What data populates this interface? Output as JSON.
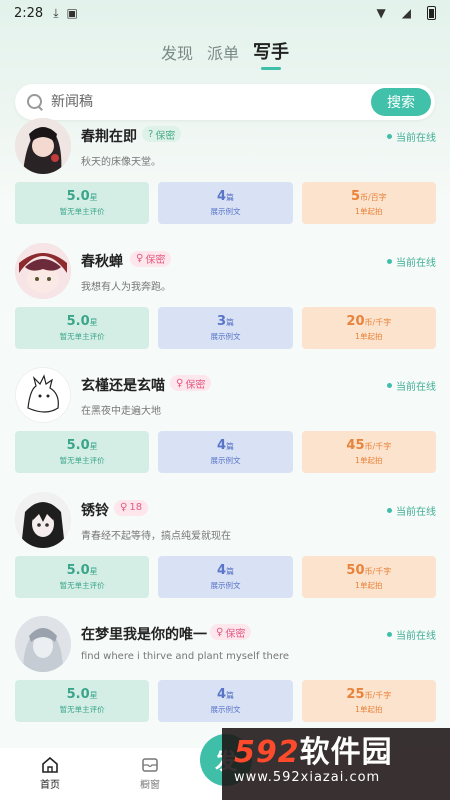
{
  "status": {
    "time": "2:28"
  },
  "tabs": [
    {
      "label": "发现"
    },
    {
      "label": "派单"
    },
    {
      "label": "写手"
    }
  ],
  "search": {
    "placeholder": "新闻稿",
    "button": "搜索"
  },
  "writers": [
    {
      "name": "春荆在即",
      "badge": "保密",
      "badge_icon": "question-icon",
      "badge_color": "green",
      "desc": "秋天的床像天堂。",
      "online": "当前在线",
      "rating": "5.0",
      "rating_unit": "星",
      "rating_label": "暂无单主评价",
      "samples": "4",
      "samples_unit": "篇",
      "samples_label": "展示例文",
      "price": "5",
      "price_unit": "币/百字",
      "price_label": "1单起拍"
    },
    {
      "name": "春秋蝉",
      "badge": "保密",
      "badge_icon": "female-icon",
      "badge_color": "pink",
      "desc": "我想有人为我奔跑。",
      "online": "当前在线",
      "rating": "5.0",
      "rating_unit": "星",
      "rating_label": "暂无单主评价",
      "samples": "3",
      "samples_unit": "篇",
      "samples_label": "展示例文",
      "price": "20",
      "price_unit": "币/千字",
      "price_label": "1单起拍"
    },
    {
      "name": "玄槿还是玄喵",
      "badge": "保密",
      "badge_icon": "female-icon",
      "badge_color": "pink",
      "desc": "在黑夜中走遍大地",
      "online": "当前在线",
      "rating": "5.0",
      "rating_unit": "星",
      "rating_label": "暂无单主评价",
      "samples": "4",
      "samples_unit": "篇",
      "samples_label": "展示例文",
      "price": "45",
      "price_unit": "币/千字",
      "price_label": "1单起拍"
    },
    {
      "name": "锈铃",
      "badge": "18",
      "badge_icon": "female-icon",
      "badge_color": "pink",
      "desc": "青春经不起等待，搞点纯爱就现在",
      "online": "当前在线",
      "rating": "5.0",
      "rating_unit": "星",
      "rating_label": "暂无单主评价",
      "samples": "4",
      "samples_unit": "篇",
      "samples_label": "展示例文",
      "price": "50",
      "price_unit": "币/千字",
      "price_label": "1单起拍"
    },
    {
      "name": "在梦里我是你的唯一",
      "badge": "保密",
      "badge_icon": "female-icon",
      "badge_color": "pink",
      "desc": "find where i thirve and plant myself there",
      "online": "当前在线",
      "rating": "5.0",
      "rating_unit": "星",
      "rating_label": "暂无单主评价",
      "samples": "4",
      "samples_unit": "篇",
      "samples_label": "展示例文",
      "price": "25",
      "price_unit": "币/千字",
      "price_label": "1单起拍"
    }
  ],
  "nav": [
    {
      "label": "首页",
      "icon": "home-icon"
    },
    {
      "label": "橱窗",
      "icon": "mailbox-icon"
    }
  ],
  "fab": {
    "label": "发"
  },
  "watermark": {
    "big_num": "592",
    "big_text": "软件园",
    "url": "www.592xiazai.com"
  },
  "colors": {
    "accent": "#3fbfa7",
    "rating": "#3ba58a",
    "samples": "#5975c7",
    "price": "#e9823a"
  }
}
